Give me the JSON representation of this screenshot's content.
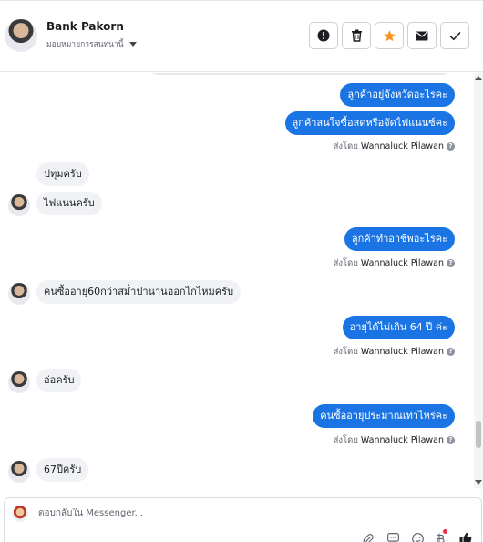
{
  "header": {
    "contact_name": "Bank Pakorn",
    "assign_label": "มอบหมายการสนทนานี้",
    "actions": [
      {
        "name": "mark-spam",
        "icon": "alert-icon"
      },
      {
        "name": "delete",
        "icon": "trash-icon"
      },
      {
        "name": "star",
        "icon": "star-icon"
      },
      {
        "name": "mark-unread",
        "icon": "envelope-icon"
      },
      {
        "name": "mark-done",
        "icon": "check-icon"
      }
    ],
    "star_color": "#f7931e"
  },
  "messages": {
    "m1": "ลูกค้าอยู่จังหวัดอะไรคะ",
    "m2": "ลูกค้าสนใจซื้อสดหรือจัดไฟแนนซ์คะ",
    "m3": "ปทุมครับ",
    "m4": "ไฟแนนครับ",
    "m5": "ลูกค้าทำอาชีพอะไรคะ",
    "m6": "คนซื้ออายุ60กว่าสม่ำปานานออกไกไหมครับ",
    "m7": "อายุได้ไม่เกิน 64 ปี ค่ะ",
    "m8": "อ่อครับ",
    "m9": "คนซื้ออายุประมาณเท่าไหร่คะ",
    "m10": "67ปีครับ"
  },
  "sent_by": {
    "prefix": "ส่งโดย",
    "agent": "Wannaluck Pilawan"
  },
  "composer": {
    "placeholder": "ตอบกลับใน Messenger..."
  },
  "colors": {
    "outgoing_bubble": "#1b74e4",
    "incoming_bubble": "#f0f2f5",
    "like_icon": "#1c1e21"
  }
}
